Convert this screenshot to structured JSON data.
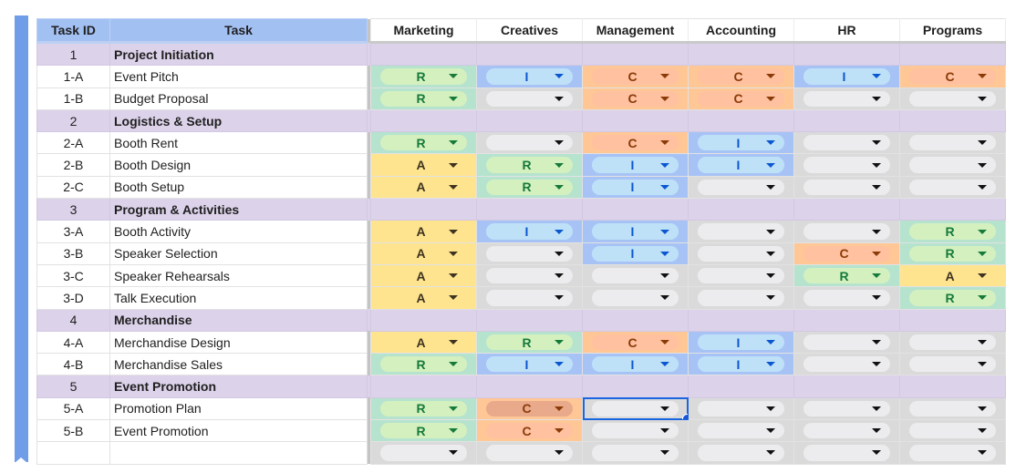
{
  "columns": {
    "task_id": "Task ID",
    "task": "Task",
    "departments": [
      "Marketing",
      "Creatives",
      "Management",
      "Accounting",
      "HR",
      "Programs"
    ]
  },
  "colors": {
    "header_blue": "#a3c0f3",
    "group_purple": "#dcd2ea",
    "R": "#d4f0bf",
    "A": "#ffe48f",
    "C": "#ffc1a0",
    "I": "#bfe1f8",
    "selection": "#1a66e0"
  },
  "rows": [
    {
      "type": "group",
      "id": "1",
      "task": "Project Initiation"
    },
    {
      "type": "task",
      "id": "1-A",
      "task": "Event Pitch",
      "roles": [
        "R",
        "I",
        "C",
        "C",
        "I",
        "C"
      ]
    },
    {
      "type": "task",
      "id": "1-B",
      "task": "Budget Proposal",
      "roles": [
        "R",
        "",
        "C",
        "C",
        "",
        ""
      ]
    },
    {
      "type": "group",
      "id": "2",
      "task": "Logistics & Setup"
    },
    {
      "type": "task",
      "id": "2-A",
      "task": "Booth Rent",
      "roles": [
        "R",
        "",
        "C",
        "I",
        "",
        ""
      ]
    },
    {
      "type": "task",
      "id": "2-B",
      "task": "Booth Design",
      "roles": [
        "A",
        "R",
        "I",
        "I",
        "",
        ""
      ]
    },
    {
      "type": "task",
      "id": "2-C",
      "task": "Booth Setup",
      "roles": [
        "A",
        "R",
        "I",
        "",
        "",
        ""
      ]
    },
    {
      "type": "group",
      "id": "3",
      "task": "Program & Activities"
    },
    {
      "type": "task",
      "id": "3-A",
      "task": "Booth Activity",
      "roles": [
        "A",
        "I",
        "I",
        "",
        "",
        "R"
      ]
    },
    {
      "type": "task",
      "id": "3-B",
      "task": "Speaker Selection",
      "roles": [
        "A",
        "",
        "I",
        "",
        "C",
        "R"
      ]
    },
    {
      "type": "task",
      "id": "3-C",
      "task": "Speaker Rehearsals",
      "roles": [
        "A",
        "",
        "",
        "",
        "R",
        "A"
      ]
    },
    {
      "type": "task",
      "id": "3-D",
      "task": "Talk Execution",
      "roles": [
        "A",
        "",
        "",
        "",
        "",
        "R"
      ]
    },
    {
      "type": "group",
      "id": "4",
      "task": "Merchandise"
    },
    {
      "type": "task",
      "id": "4-A",
      "task": "Merchandise Design",
      "roles": [
        "A",
        "R",
        "C",
        "I",
        "",
        ""
      ]
    },
    {
      "type": "task",
      "id": "4-B",
      "task": "Merchandise Sales",
      "roles": [
        "R",
        "I",
        "I",
        "I",
        "",
        ""
      ]
    },
    {
      "type": "group",
      "id": "5",
      "task": "Event Promotion"
    },
    {
      "type": "task",
      "id": "5-A",
      "task": "Promotion Plan",
      "roles": [
        "R",
        "C",
        "",
        "",
        "",
        ""
      ]
    },
    {
      "type": "task",
      "id": "5-B",
      "task": "Event Promotion",
      "roles": [
        "R",
        "C",
        "",
        "",
        "",
        ""
      ]
    },
    {
      "type": "task",
      "id": "",
      "task": "",
      "roles": [
        "",
        "",
        "",
        "",
        "",
        ""
      ]
    }
  ],
  "selected_cell": {
    "row_id": "5-A",
    "department": "Management"
  },
  "hovered_cell": {
    "row_id": "5-A",
    "department": "Creatives"
  }
}
